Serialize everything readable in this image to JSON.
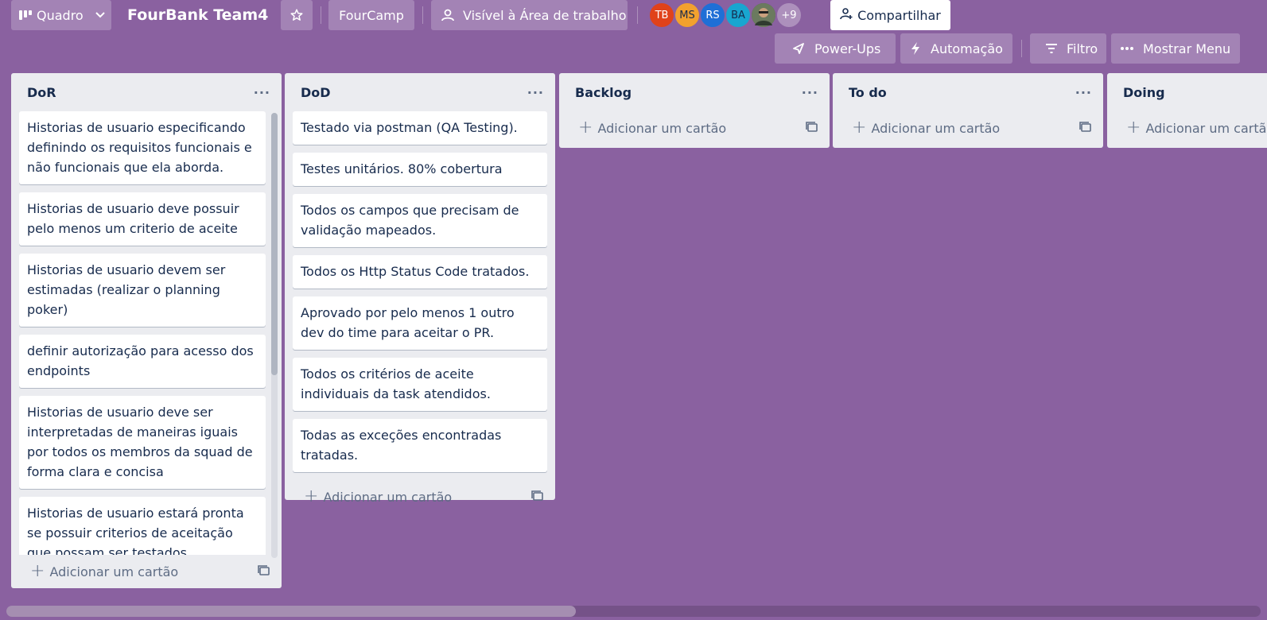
{
  "header": {
    "view_label": "Quadro",
    "board_title": "FourBank Team4",
    "workspace": "FourCamp",
    "visibility": "Visível à Área de trabalho",
    "members": [
      {
        "initials": "TB",
        "color": "#e0421a",
        "text": "#ffffff"
      },
      {
        "initials": "MS",
        "color": "#f2a12e",
        "text": "#172b4d"
      },
      {
        "initials": "RS",
        "color": "#1f6fd6",
        "text": "#ffffff"
      },
      {
        "initials": "BA",
        "color": "#18a6d0",
        "text": "#172b4d"
      }
    ],
    "more_members": "+9",
    "share_label": "Compartilhar",
    "powerups_label": "Power-Ups",
    "automation_label": "Automação",
    "filter_label": "Filtro",
    "menu_label": "Mostrar Menu"
  },
  "lists": [
    {
      "title": "DoR",
      "cards": [
        "Historias de usuario especificando definindo os requisitos funcionais e não funcionais que ela aborda.",
        "Historias de usuario deve possuir pelo menos um criterio de aceite",
        "Historias de usuario devem ser estimadas (realizar o planning poker)",
        "definir autorização para acesso dos endpoints",
        "Historias de usuario deve ser interpretadas de maneiras iguais por todos os membros da squad de forma clara e concisa",
        "Historias de usuario estará pronta se possuir criterios de aceitação que possam ser testados objetivamente"
      ],
      "add_label": "Adicionar um cartão"
    },
    {
      "title": "DoD",
      "cards": [
        "Testado via postman (QA Testing).",
        "Testes unitários. 80% cobertura",
        "Todos os campos que precisam de validação mapeados.",
        "Todos os Http Status Code tratados.",
        "Aprovado por pelo menos 1 outro dev do time para aceitar o PR.",
        "Todos os critérios de aceite individuais da task atendidos.",
        "Todas as exceções encontradas tratadas."
      ],
      "add_label": "Adicionar um cartão"
    },
    {
      "title": "Backlog",
      "cards": [],
      "add_label": "Adicionar um cartão"
    },
    {
      "title": "To do",
      "cards": [],
      "add_label": "Adicionar um cartão"
    },
    {
      "title": "Doing",
      "cards": [],
      "add_label": "Adicionar um cartão"
    }
  ]
}
